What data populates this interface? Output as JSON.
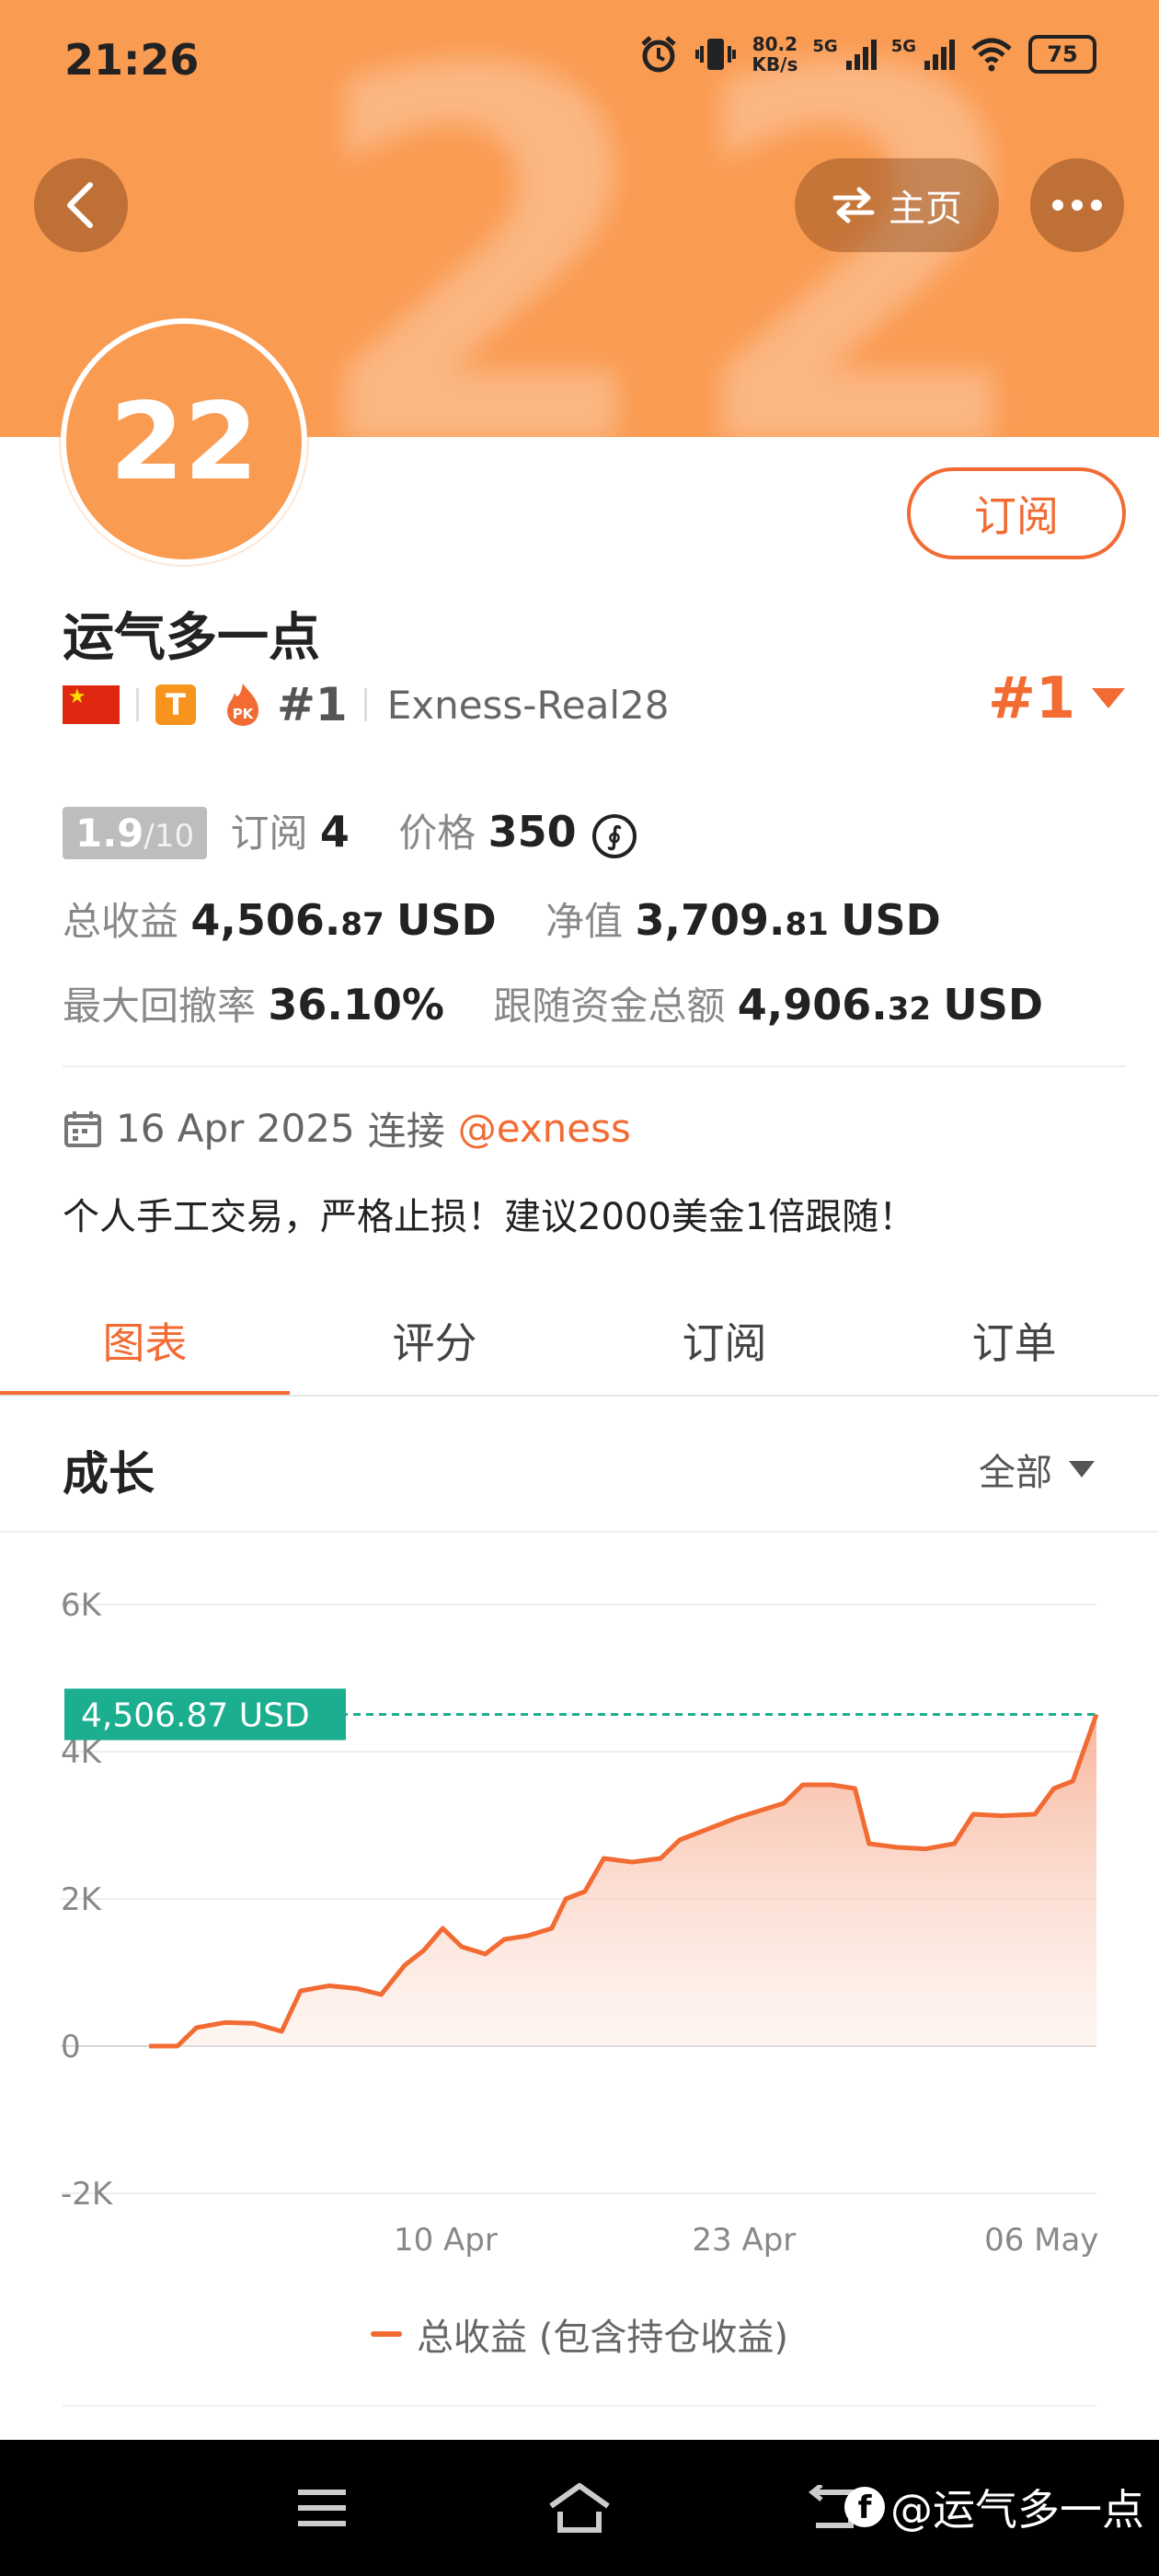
{
  "status_bar": {
    "time": "21:26",
    "net_speed_value": "80.2",
    "net_speed_unit": "KB/s",
    "sim1_label": "5G",
    "sim2_label": "5G",
    "battery": "75"
  },
  "header": {
    "home_label": "主页",
    "avatar_text": "22",
    "subscribe_label": "订阅"
  },
  "profile": {
    "name": "运气多一点",
    "t_badge": "T",
    "pk_badge": "PK",
    "rank": "#1",
    "server": "Exness-Real28",
    "rank_right": "#1"
  },
  "stats": {
    "score": "1.9",
    "score_max": "/10",
    "subscriptions_label": "订阅",
    "subscriptions_value": "4",
    "price_label": "价格",
    "price_value": "350",
    "coin_symbol": "∮",
    "total_profit_label": "总收益",
    "total_profit_int": "4,506.",
    "total_profit_dec": "87",
    "total_profit_unit": "USD",
    "equity_label": "净值",
    "equity_int": "3,709.",
    "equity_dec": "81",
    "equity_unit": "USD",
    "max_drawdown_label": "最大回撤率",
    "max_drawdown_value": "36.10%",
    "follow_funds_label": "跟随资金总额",
    "follow_funds_int": "4,906.",
    "follow_funds_dec": "32",
    "follow_funds_unit": "USD"
  },
  "connection": {
    "date": "16 Apr 2025",
    "connected_label": "连接",
    "broker": "@exness"
  },
  "bio": "个人手工交易，严格止损！建议2000美金1倍跟随！",
  "tabs": [
    {
      "label": "图表",
      "active": true
    },
    {
      "label": "评分",
      "active": false
    },
    {
      "label": "订阅",
      "active": false
    },
    {
      "label": "订单",
      "active": false
    }
  ],
  "section": {
    "title": "成长",
    "range": "全部"
  },
  "chart_data": {
    "type": "area",
    "title": "",
    "xlabel": "",
    "ylabel": "",
    "ylim": [
      -2000,
      6000
    ],
    "y_ticks": [
      "6K",
      "4K",
      "2K",
      "0",
      "-2K"
    ],
    "x_ticks": [
      "10 Apr",
      "23 Apr",
      "06 May"
    ],
    "current_value_label": "4,506.87 USD",
    "current_value": 4506.87,
    "series": [
      {
        "name": "总收益 (包含持仓收益)",
        "color": "#F26B33",
        "points": [
          [
            0.0,
            0
          ],
          [
            0.03,
            0
          ],
          [
            0.05,
            250
          ],
          [
            0.08,
            320
          ],
          [
            0.11,
            310
          ],
          [
            0.14,
            200
          ],
          [
            0.16,
            750
          ],
          [
            0.19,
            820
          ],
          [
            0.22,
            780
          ],
          [
            0.245,
            700
          ],
          [
            0.27,
            1100
          ],
          [
            0.29,
            1300
          ],
          [
            0.31,
            1600
          ],
          [
            0.33,
            1350
          ],
          [
            0.355,
            1250
          ],
          [
            0.375,
            1450
          ],
          [
            0.4,
            1500
          ],
          [
            0.425,
            1600
          ],
          [
            0.44,
            2000
          ],
          [
            0.46,
            2100
          ],
          [
            0.48,
            2550
          ],
          [
            0.51,
            2500
          ],
          [
            0.54,
            2550
          ],
          [
            0.56,
            2800
          ],
          [
            0.59,
            2950
          ],
          [
            0.62,
            3100
          ],
          [
            0.645,
            3200
          ],
          [
            0.67,
            3300
          ],
          [
            0.69,
            3550
          ],
          [
            0.72,
            3550
          ],
          [
            0.745,
            3500
          ],
          [
            0.76,
            2750
          ],
          [
            0.79,
            2700
          ],
          [
            0.82,
            2680
          ],
          [
            0.85,
            2750
          ],
          [
            0.87,
            3150
          ],
          [
            0.9,
            3130
          ],
          [
            0.935,
            3150
          ],
          [
            0.955,
            3500
          ],
          [
            0.975,
            3600
          ],
          [
            1.0,
            4506.87
          ]
        ]
      }
    ],
    "legend_position": "bottom",
    "grid": true
  },
  "legend": {
    "label": "总收益 (包含持仓收益)"
  },
  "watermark": "@运气多一点",
  "colors": {
    "accent": "#F26B33",
    "header_bg": "#FA9B52",
    "value_tag": "#1BAE8F"
  }
}
